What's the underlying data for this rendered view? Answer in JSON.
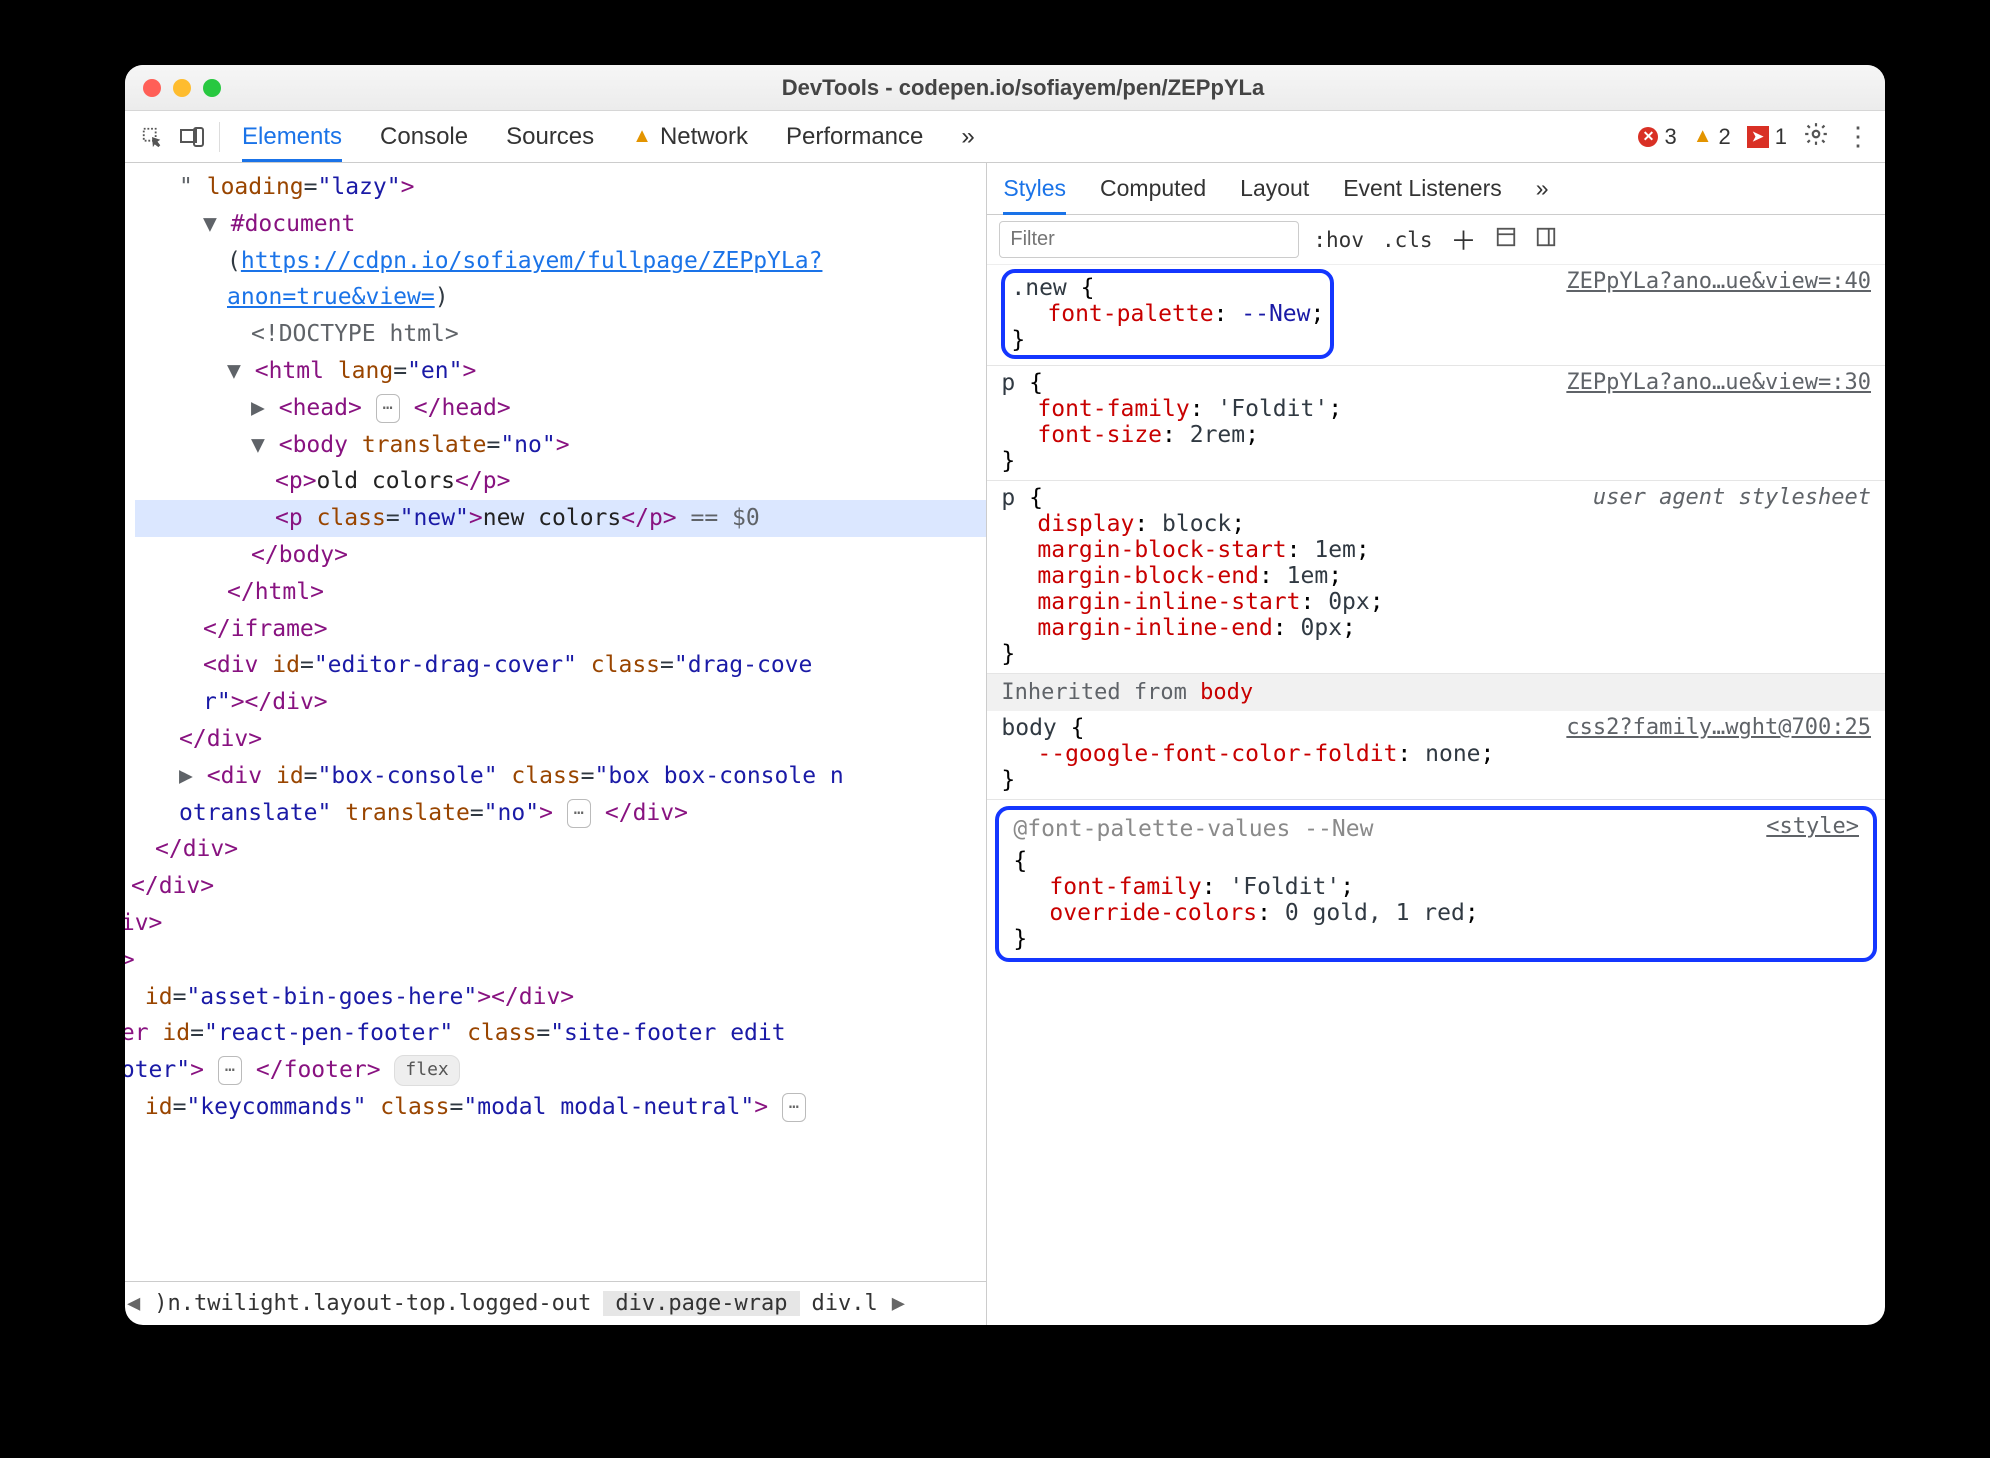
{
  "window": {
    "title": "DevTools - codepen.io/sofiayem/pen/ZEPpYLa"
  },
  "topbar": {
    "tabs": [
      "Elements",
      "Console",
      "Sources",
      "Network",
      "Performance"
    ],
    "more": "»",
    "errors": "3",
    "warnings": "2",
    "messages": "1"
  },
  "tree": {
    "lines": [
      {
        "indent": 1,
        "html": "<span class='gray'>\"</span> <span class='attr'>loading</span>=<span class='aval'>\"lazy\"</span><span class='tag'>></span>"
      },
      {
        "indent": 2,
        "html": "<span class='gray'>▼</span> <span class='tag'>#document</span>"
      },
      {
        "indent": 3,
        "html": "(<span class='link'>https://cdpn.io/sofiayem/fullpage/ZEPpYLa?</span>"
      },
      {
        "indent": 3,
        "html": "<span class='link'>anon=true&view=</span>)"
      },
      {
        "indent": 4,
        "html": "<span class='gray'>&lt;!DOCTYPE html&gt;</span>"
      },
      {
        "indent": 3,
        "html": "<span class='gray'>▼</span> <span class='tag'>&lt;html</span> <span class='attr'>lang</span>=<span class='aval'>\"en\"</span><span class='tag'>&gt;</span>"
      },
      {
        "indent": 4,
        "html": "<span class='gray'>▶</span> <span class='tag'>&lt;head&gt;</span> <span class='pill'>⋯</span> <span class='tag'>&lt;/head&gt;</span>"
      },
      {
        "indent": 4,
        "html": "<span class='gray'>▼</span> <span class='tag'>&lt;body</span> <span class='attr'>translate</span>=<span class='aval'>\"no\"</span><span class='tag'>&gt;</span>"
      },
      {
        "indent": 5,
        "html": "<span class='tag'>&lt;p&gt;</span><span class='txt'>old colors</span><span class='tag'>&lt;/p&gt;</span>"
      },
      {
        "indent": 5,
        "sel": true,
        "html": "<span class='tag'>&lt;p</span> <span class='attr'>class</span>=<span class='aval'>\"new\"</span><span class='tag'>&gt;</span><span class='txt'>new colors</span><span class='tag'>&lt;/p&gt;</span> <span class='gray'>== $0</span>"
      },
      {
        "indent": 4,
        "html": "<span class='tag'>&lt;/body&gt;</span>"
      },
      {
        "indent": 3,
        "html": "<span class='tag'>&lt;/html&gt;</span>"
      },
      {
        "indent": 2,
        "html": "<span class='tag'>&lt;/iframe&gt;</span>"
      },
      {
        "indent": 2,
        "html": "<span class='tag'>&lt;div</span> <span class='attr'>id</span>=<span class='aval'>\"editor-drag-cover\"</span> <span class='attr'>class</span>=<span class='aval'>\"drag-cove</span>"
      },
      {
        "indent": 2,
        "html": "<span class='aval'>r\"</span><span class='tag'>&gt;&lt;/div&gt;</span>"
      },
      {
        "indent": 1,
        "html": "<span class='tag'>&lt;/div&gt;</span>"
      },
      {
        "indent": 1,
        "html": "<span class='gray'>▶</span> <span class='tag'>&lt;div</span> <span class='attr'>id</span>=<span class='aval'>\"box-console\"</span> <span class='attr'>class</span>=<span class='aval'>\"box box-console n</span>"
      },
      {
        "indent": 1,
        "html": "<span class='aval'>otranslate\"</span> <span class='attr'>translate</span>=<span class='aval'>\"no\"</span><span class='tag'>&gt;</span> <span class='pill'>⋯</span> <span class='tag'>&lt;/div&gt;</span>"
      },
      {
        "indent": 0,
        "html": "<span class='tag'>&lt;/div&gt;</span>"
      },
      {
        "indent": -1,
        "html": "<span class='tag'>&lt;/div&gt;</span>"
      },
      {
        "indent": -2,
        "html": "<span class='tag'>div&gt;</span>"
      },
      {
        "indent": -2,
        "html": "<span class='tag'>v&gt;</span>"
      },
      {
        "indent": -1,
        "html": " <span class='attr'>id</span>=<span class='aval'>\"asset-bin-goes-here\"</span><span class='tag'>&gt;&lt;/div&gt;</span>"
      },
      {
        "indent": -2,
        "html": "<span class='tag'>ter</span> <span class='attr'>id</span>=<span class='aval'>\"react-pen-footer\"</span> <span class='attr'>class</span>=<span class='aval'>\"site-footer edit</span>"
      },
      {
        "indent": -2,
        "html": "<span class='aval'>ooter\"</span><span class='tag'>&gt;</span> <span class='pill'>⋯</span> <span class='tag'>&lt;/footer&gt;</span> <span class='flexpill'>flex</span>"
      },
      {
        "indent": -1,
        "html": " <span class='attr'>id</span>=<span class='aval'>\"keycommands\"</span> <span class='attr'>class</span>=<span class='aval'>\"modal modal-neutral\"</span><span class='tag'>&gt;</span> <span class='pill'>⋯</span>"
      }
    ]
  },
  "crumbs": {
    "first": ")n.twilight.layout-top.logged-out",
    "second": "div.page-wrap",
    "third": "div.l"
  },
  "styles": {
    "tabs": [
      "Styles",
      "Computed",
      "Layout",
      "Event Listeners"
    ],
    "filter_placeholder": "Filter",
    "controls": {
      "hov": ":hov",
      "cls": ".cls"
    },
    "rules": [
      {
        "selector": ".new",
        "source": "ZEPpYLa?ano…ue&view=:40",
        "highlight": "box",
        "decls": [
          {
            "prop": "font-palette",
            "val": "--New",
            "valcls": "cval"
          }
        ]
      },
      {
        "selector": "p",
        "source": "ZEPpYLa?ano…ue&view=:30",
        "decls": [
          {
            "prop": "font-family",
            "val": "'Foldit'"
          },
          {
            "prop": "font-size",
            "val": "2rem"
          }
        ]
      },
      {
        "selector": "p",
        "source": "user agent stylesheet",
        "ua": true,
        "decls": [
          {
            "prop": "display",
            "val": "block"
          },
          {
            "prop": "margin-block-start",
            "val": "1em"
          },
          {
            "prop": "margin-block-end",
            "val": "1em"
          },
          {
            "prop": "margin-inline-start",
            "val": "0px"
          },
          {
            "prop": "margin-inline-end",
            "val": "0px"
          }
        ]
      }
    ],
    "inherit_label": "Inherited from ",
    "inherit_from": "body",
    "body_rule": {
      "selector": "body",
      "source": "css2?family…wght@700:25",
      "decls": [
        {
          "prop": "--google-font-color-foldit",
          "val": "none"
        }
      ]
    },
    "fpv": {
      "header": "@font-palette-values --New",
      "source": "<style>",
      "decls": [
        {
          "prop": "font-family",
          "val": "'Foldit'"
        },
        {
          "prop": "override-colors",
          "val": "0 gold, 1 red"
        }
      ]
    }
  }
}
